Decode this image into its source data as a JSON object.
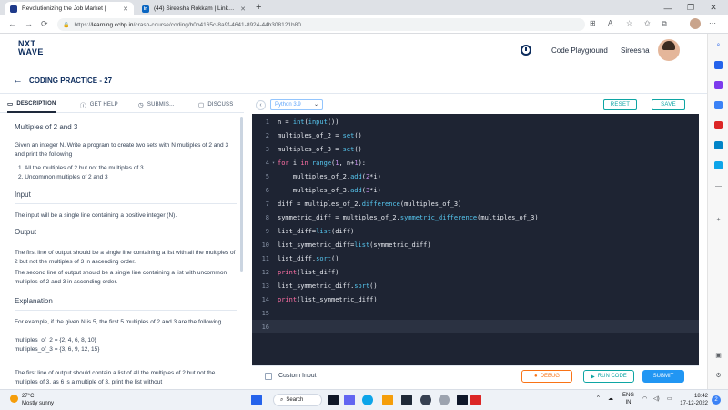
{
  "browser": {
    "tabs": [
      {
        "title": "Revolutionizing the Job Market |",
        "active": true
      },
      {
        "title": "(44) Sireesha Rokkam | LinkedIn",
        "active": false
      }
    ],
    "url_host": "learning.ccbp.in",
    "url_path": "/crash-course/coding/b0b4165c-8a9f-4641-8924-44b308121b80"
  },
  "header": {
    "logo_line1": "NXT",
    "logo_line2": "WAVE",
    "playground_label": "Code Playground",
    "username": "Sireesha"
  },
  "page": {
    "title": "CODING PRACTICE - 27"
  },
  "left_tabs": {
    "description": "DESCRIPTION",
    "get_help": "GET HELP",
    "submissions": "SUBMIS...",
    "discuss": "DISCUSS"
  },
  "problem": {
    "title": "Multiples of 2 and 3",
    "statement": "Given an integer N. Write a program to create two sets with N multiples of 2 and 3 and print the following",
    "items": [
      "1. All the multiples of 2 but not the multiples of 3",
      "2. Uncommon multiples of 2 and 3"
    ],
    "input_heading": "Input",
    "input_text": "The input will be a single line containing a positive integer (N).",
    "output_heading": "Output",
    "output_text_1": "The first line of output should be a single line containing a list with all the multiples of 2 but not the multiples of 3 in ascending order.",
    "output_text_2": "The second line of output should be a single line containing a list with uncommon multiples of 2 and 3 in ascending order.",
    "explanation_heading": "Explanation",
    "explanation_text": "For example, if the given N is 5, the first 5 multiples of 2 and 3 are the following",
    "example_1": "multiples_of_2 = {2, 4, 6, 8, 10}",
    "example_2": "multiples_of_3 = {3, 6, 9, 12, 15}",
    "explanation_more": "The first line of output should contain a list of all the multiples of 2 but not the multiples of 3, as 6 is a multiple of 3, print the list without"
  },
  "editor": {
    "language": "Python 3.9",
    "reset_label": "RESET",
    "save_label": "SAVE",
    "lines": [
      {
        "n": "1",
        "fold": "",
        "html": "n = <span class=\"fn\">int</span>(<span class=\"fn\">input</span>())"
      },
      {
        "n": "2",
        "fold": "",
        "html": "multiples_of_2 = <span class=\"fn\">set</span>()"
      },
      {
        "n": "3",
        "fold": "",
        "html": "multiples_of_3 = <span class=\"fn\">set</span>()"
      },
      {
        "n": "4",
        "fold": "▾",
        "html": "<span class=\"kw\">for</span> i <span class=\"kw\">in</span> <span class=\"fn\">range</span>(<span class=\"num\">1</span>, n+<span class=\"num\">1</span>):"
      },
      {
        "n": "5",
        "fold": "",
        "html": "    multiples_of_2.<span class=\"fn\">add</span>(<span class=\"num\">2</span>*i)"
      },
      {
        "n": "6",
        "fold": "",
        "html": "    multiples_of_3.<span class=\"fn\">add</span>(<span class=\"num\">3</span>*i)"
      },
      {
        "n": "7",
        "fold": "",
        "html": "diff = multiples_of_2.<span class=\"fn\">difference</span>(multiples_of_3)"
      },
      {
        "n": "8",
        "fold": "",
        "html": "symmetric_diff = multiples_of_2.<span class=\"fn\">symmetric_difference</span>(multiples_of_3)"
      },
      {
        "n": "9",
        "fold": "",
        "html": "list_diff=<span class=\"fn\">list</span>(diff)"
      },
      {
        "n": "10",
        "fold": "",
        "html": "list_symmetric_diff=<span class=\"fn\">list</span>(symmetric_diff)"
      },
      {
        "n": "11",
        "fold": "",
        "html": "list_diff.<span class=\"fn\">sort</span>()"
      },
      {
        "n": "12",
        "fold": "",
        "html": "<span class=\"kw\">print</span>(list_diff)"
      },
      {
        "n": "13",
        "fold": "",
        "html": "list_symmetric_diff.<span class=\"fn\">sort</span>()"
      },
      {
        "n": "14",
        "fold": "",
        "html": "<span class=\"kw\">print</span>(list_symmetric_diff)"
      },
      {
        "n": "15",
        "fold": "",
        "html": ""
      },
      {
        "n": "16",
        "fold": "",
        "html": ""
      }
    ],
    "current_line": "16"
  },
  "bottom": {
    "custom_input_label": "Custom Input",
    "debug_label": "DEBUG",
    "run_label": "RUN CODE",
    "submit_label": "SUBMIT"
  },
  "taskbar": {
    "temperature": "27°C",
    "weather": "Mostly sunny",
    "search_label": "Search",
    "lang_top": "ENG",
    "lang_bottom": "IN",
    "time": "18:42",
    "date": "17-12-2022",
    "notification_count": "2"
  },
  "colors": {
    "brand_navy": "#0b2b5c",
    "accent_teal": "#0ea5a4",
    "submit_blue": "#2196f3",
    "debug_orange": "#f97316",
    "editor_bg": "#1e2433"
  }
}
